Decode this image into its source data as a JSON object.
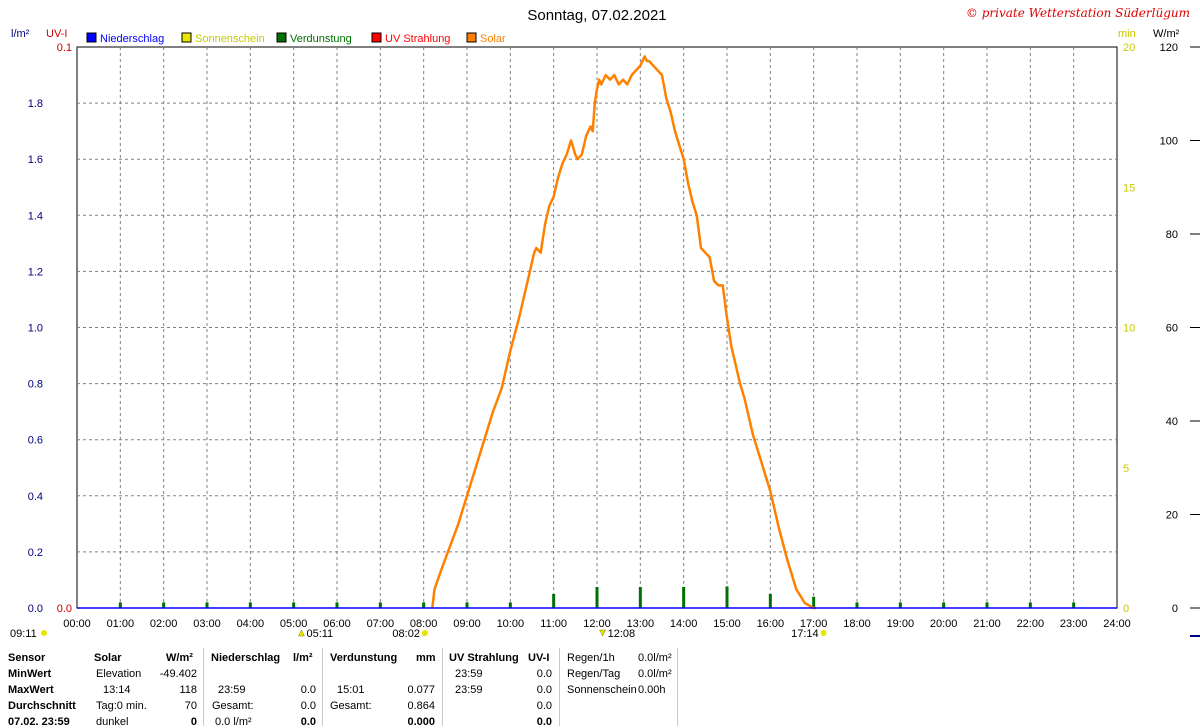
{
  "chart_data": {
    "type": "line",
    "title": "Sonntag, 07.02.2021",
    "watermark": "© private Wetterstation Süderlügum",
    "legend": [
      {
        "name": "Niederschlag",
        "color": "#0000ff"
      },
      {
        "name": "Sonnenschein",
        "color": "#e6e600"
      },
      {
        "name": "Verdunstung",
        "color": "#007000"
      },
      {
        "name": "UV Strahlung",
        "color": "#ff0000"
      },
      {
        "name": "Solar",
        "color": "#ff8000"
      }
    ],
    "axes": {
      "left1": {
        "unit": "l/m²",
        "color": "#000080",
        "ticks": [
          "0.0",
          "0.2",
          "0.4",
          "0.6",
          "0.8",
          "1.0",
          "1.2",
          "1.4",
          "1.6",
          "1.8"
        ],
        "range": [
          0,
          2
        ]
      },
      "left2": {
        "unit": "UV-I",
        "color": "#cc0000",
        "ticks": [
          "0.0",
          "0.1"
        ],
        "range": [
          0,
          0.1
        ]
      },
      "right1": {
        "unit": "min",
        "color": "#c8c800",
        "ticks": [
          "0",
          "5",
          "10",
          "15",
          "20"
        ],
        "range": [
          0,
          20
        ]
      },
      "right2": {
        "unit": "W/m²",
        "color": "#000000",
        "ticks": [
          "0",
          "20",
          "40",
          "60",
          "80",
          "100",
          "120"
        ],
        "range": [
          0,
          120
        ]
      },
      "x": {
        "ticks": [
          "00:00",
          "01:00",
          "02:00",
          "03:00",
          "04:00",
          "05:00",
          "06:00",
          "07:00",
          "08:00",
          "09:00",
          "10:00",
          "11:00",
          "12:00",
          "13:00",
          "14:00",
          "15:00",
          "16:00",
          "17:00",
          "18:00",
          "19:00",
          "20:00",
          "21:00",
          "22:00",
          "23:00",
          "24:00"
        ],
        "range_hours": [
          0,
          24
        ]
      }
    },
    "markers": [
      {
        "label": "09:11",
        "hour": null
      },
      {
        "label": "05:11",
        "hour": 5.18
      },
      {
        "label": "08:02",
        "hour": 8.03
      },
      {
        "label": "12:08",
        "hour": 12.13
      },
      {
        "label": "17:14",
        "hour": 17.23
      }
    ],
    "series": [
      {
        "name": "Solar",
        "color": "#ff8000",
        "axis": "W/m²",
        "x": [
          8.2,
          8.25,
          8.4,
          8.6,
          8.8,
          9.0,
          9.2,
          9.4,
          9.6,
          9.8,
          10.0,
          10.2,
          10.4,
          10.55,
          10.6,
          10.7,
          10.8,
          10.9,
          11.0,
          11.1,
          11.2,
          11.3,
          11.4,
          11.5,
          11.55,
          11.65,
          11.75,
          11.85,
          11.9,
          11.95,
          12.0,
          12.05,
          12.1,
          12.2,
          12.3,
          12.4,
          12.5,
          12.6,
          12.7,
          12.8,
          12.9,
          13.0,
          13.1,
          13.15,
          13.2,
          13.3,
          13.4,
          13.5,
          13.6,
          13.7,
          13.8,
          13.9,
          14.0,
          14.1,
          14.2,
          14.3,
          14.4,
          14.5,
          14.6,
          14.7,
          14.8,
          14.9,
          15.0,
          15.1,
          15.2,
          15.3,
          15.4,
          15.5,
          15.6,
          15.8,
          16.0,
          16.2,
          16.4,
          16.6,
          16.8,
          17.0,
          17.05
        ],
        "y": [
          0,
          4,
          8,
          13,
          18,
          24,
          30,
          36,
          42,
          47,
          55,
          62,
          70,
          76,
          77,
          76,
          82,
          86,
          88,
          92,
          95,
          97,
          100,
          97,
          96,
          97,
          101,
          103,
          102,
          108,
          111,
          113,
          112,
          114,
          113,
          114,
          112,
          113,
          112,
          114,
          115,
          116,
          118,
          117,
          117,
          116,
          115,
          114,
          109,
          106,
          102,
          99,
          96,
          91,
          87,
          84,
          77,
          76,
          75,
          70,
          69,
          69,
          62,
          56,
          52,
          48,
          45,
          41,
          37,
          31,
          25,
          17,
          10,
          4,
          1,
          0,
          0
        ]
      },
      {
        "name": "Verdunstung",
        "color": "#007000",
        "axis": "l/m²",
        "x": [
          1,
          2,
          3,
          4,
          5,
          6,
          7,
          8,
          9,
          10,
          11,
          12,
          13,
          14,
          15,
          16,
          17,
          18,
          19,
          20,
          21,
          22,
          23
        ],
        "y": [
          0.02,
          0.02,
          0.02,
          0.02,
          0.02,
          0.02,
          0.02,
          0.02,
          0.02,
          0.02,
          0.05,
          0.075,
          0.075,
          0.075,
          0.077,
          0.05,
          0.04,
          0.02,
          0.02,
          0.02,
          0.02,
          0.02,
          0.02
        ]
      }
    ]
  },
  "table": {
    "col1": {
      "header": "Sensor",
      "rows": [
        "MinWert",
        "MaxWert",
        "Durchschnitt",
        "07.02. 23:59"
      ]
    },
    "solar": {
      "header": "Solar",
      "unit": "W/m²",
      "rows": [
        [
          "Elevation",
          "-49.402"
        ],
        [
          "13:14",
          "118"
        ],
        [
          "Tag:0 min.",
          "70"
        ],
        [
          "dunkel",
          "0"
        ]
      ]
    },
    "niederschlag": {
      "header": "Niederschlag",
      "unit": "l/m²",
      "rows": [
        [
          "",
          ""
        ],
        [
          "23:59",
          "0.0"
        ],
        [
          "Gesamt:",
          "0.0"
        ],
        [
          "0.0 l/m²",
          "0.0"
        ]
      ]
    },
    "verdunstung": {
      "header": "Verdunstung",
      "unit": "mm",
      "rows": [
        [
          "",
          ""
        ],
        [
          "15:01",
          "0.077"
        ],
        [
          "Gesamt:",
          "0.864"
        ],
        [
          "",
          "0.000"
        ]
      ]
    },
    "uv": {
      "header": "UV Strahlung",
      "unit": "UV-I",
      "rows": [
        [
          "23:59",
          "0.0"
        ],
        [
          "23:59",
          "0.0"
        ],
        [
          "",
          "0.0"
        ],
        [
          "",
          "0.0"
        ]
      ]
    },
    "extra": {
      "rows": [
        [
          "Regen/1h",
          "0.0l/m²"
        ],
        [
          "Regen/Tag",
          "0.0l/m²"
        ],
        [
          "Sonnenschein",
          "0.00h"
        ]
      ]
    }
  }
}
